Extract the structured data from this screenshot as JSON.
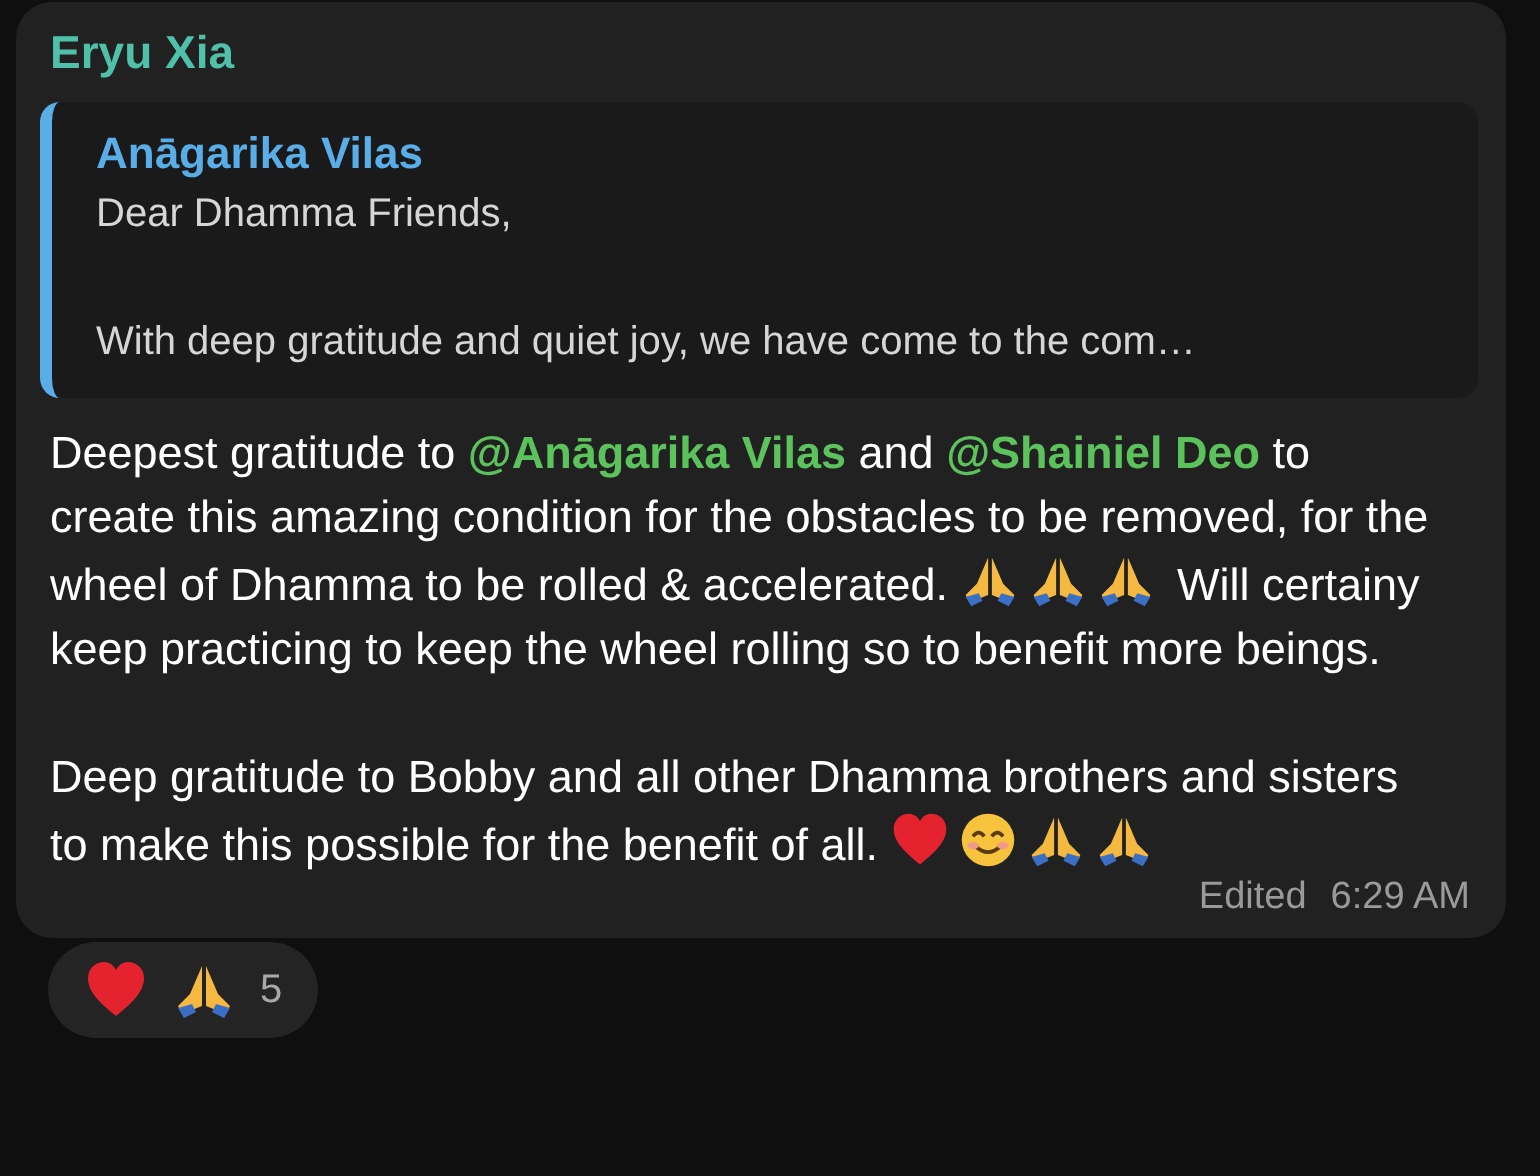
{
  "message": {
    "sender": "Eryu Xia",
    "quote": {
      "author": "Anāgarika Vilas",
      "paragraphs": [
        "Dear Dhamma Friends,",
        "With deep gratitude and quiet joy, we have come to the com…"
      ]
    },
    "paragraphs": [
      [
        {
          "kind": "text",
          "text": "Deepest gratitude to "
        },
        {
          "kind": "mention",
          "text": "@Anāgarika Vilas"
        },
        {
          "kind": "text",
          "text": " and "
        },
        {
          "kind": "mention",
          "text": "@Shainiel Deo"
        },
        {
          "kind": "text",
          "text": " to create this amazing condition for the obstacles to be removed, for the wheel of Dhamma to be rolled & accelerated. "
        },
        {
          "kind": "pray"
        },
        {
          "kind": "pray"
        },
        {
          "kind": "pray"
        },
        {
          "kind": "text",
          "text": " Will certainy keep practicing to keep the wheel rolling so to benefit more beings."
        }
      ],
      [
        {
          "kind": "text",
          "text": "Deep gratitude to Bobby and all other Dhamma brothers and sisters to make this possible for the benefit of all. "
        },
        {
          "kind": "heart"
        },
        {
          "kind": "smile"
        },
        {
          "kind": "pray"
        },
        {
          "kind": "pray"
        }
      ]
    ],
    "edited": "Edited",
    "time": "6:29 AM",
    "reactions": {
      "icons": [
        {
          "kind": "heart"
        },
        {
          "kind": "pray"
        }
      ],
      "count": "5"
    }
  }
}
